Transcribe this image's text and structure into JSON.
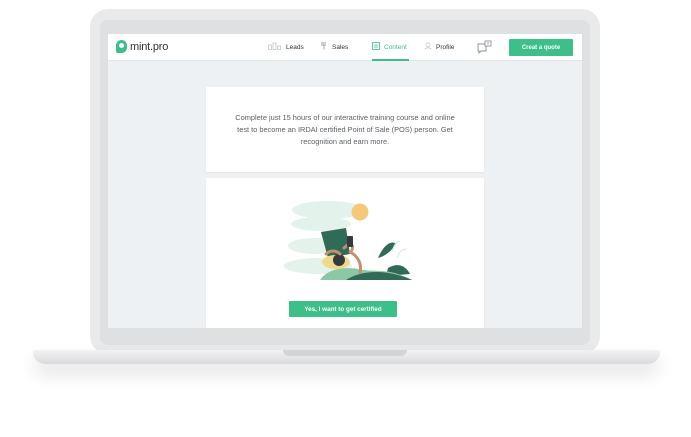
{
  "app": {
    "logo_text": "mint.pro"
  },
  "nav": {
    "items": [
      {
        "label": "Leads",
        "icon": "leads-icon"
      },
      {
        "label": "Sales",
        "icon": "sales-icon"
      },
      {
        "label": "Content",
        "icon": "content-icon",
        "active": true
      },
      {
        "label": "Profile",
        "icon": "profile-icon"
      }
    ],
    "notification_icon": "bell-icon",
    "quote_button": "Creat a quote"
  },
  "main": {
    "info_text": "Complete just 15 hours of our interactive training course and online test to become an IRDAI certified Point of Sale (POS) person. Get recognition and earn more.",
    "cta_button": "Yes, I want to get certified",
    "illustration": "person-reading-phone-illustration"
  },
  "colors": {
    "accent": "#3dbf8a",
    "dark_green": "#2f6b57",
    "sun": "#f4c97a",
    "background": "#eef1f3"
  }
}
